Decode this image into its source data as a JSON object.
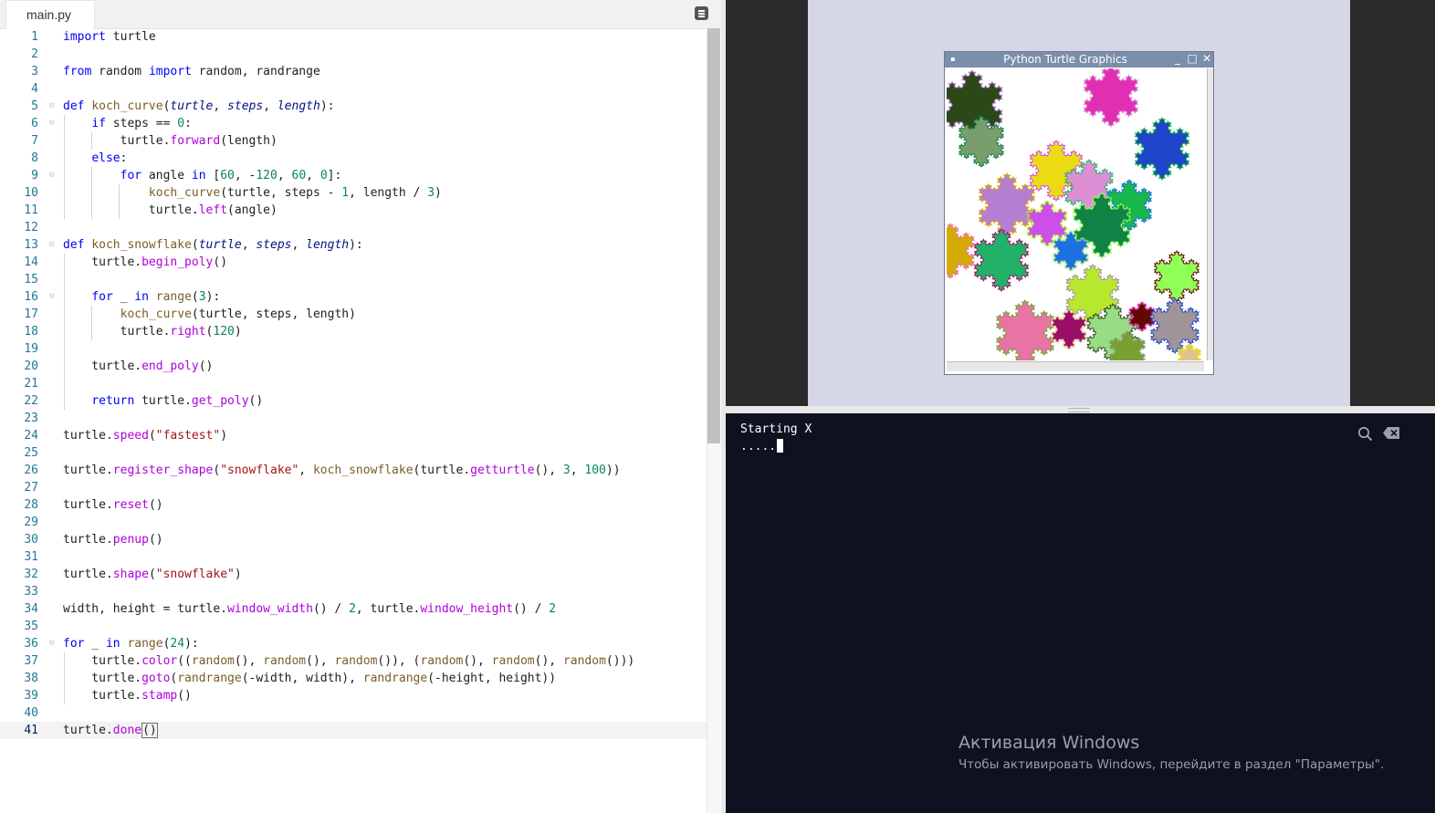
{
  "editor": {
    "tab_name": "main.py",
    "lines": [
      "import turtle",
      "",
      "from random import random, randrange",
      "",
      "def koch_curve(turtle, steps, length):",
      "    if steps == 0:",
      "        turtle.forward(length)",
      "    else:",
      "        for angle in [60, -120, 60, 0]:",
      "            koch_curve(turtle, steps - 1, length / 3)",
      "            turtle.left(angle)",
      "",
      "def koch_snowflake(turtle, steps, length):",
      "    turtle.begin_poly()",
      "",
      "    for _ in range(3):",
      "        koch_curve(turtle, steps, length)",
      "        turtle.right(120)",
      "",
      "    turtle.end_poly()",
      "",
      "    return turtle.get_poly()",
      "",
      "turtle.speed(\"fastest\")",
      "",
      "turtle.register_shape(\"snowflake\", koch_snowflake(turtle.getturtle(), 3, 100))",
      "",
      "turtle.reset()",
      "",
      "turtle.penup()",
      "",
      "turtle.shape(\"snowflake\")",
      "",
      "width, height = turtle.window_width() / 2, turtle.window_height() / 2",
      "",
      "for _ in range(24):",
      "    turtle.color((random(), random(), random()), (random(), random(), random()))",
      "    turtle.goto(randrange(-width, width), randrange(-height, height))",
      "    turtle.stamp()",
      "",
      "turtle.done()"
    ],
    "active_line": 41,
    "line_numbers": [
      "1",
      "2",
      "3",
      "4",
      "5",
      "6",
      "7",
      "8",
      "9",
      "10",
      "11",
      "12",
      "13",
      "14",
      "15",
      "16",
      "17",
      "18",
      "19",
      "20",
      "21",
      "22",
      "23",
      "24",
      "25",
      "26",
      "27",
      "28",
      "29",
      "30",
      "31",
      "32",
      "33",
      "34",
      "35",
      "36",
      "37",
      "38",
      "39",
      "40",
      "41"
    ]
  },
  "turtle_window": {
    "title": "Python Turtle Graphics",
    "snowflake_colors": [
      "#2c4718",
      "#e12fb4",
      "#1f45c8",
      "#7a9d6e",
      "#ecdb13",
      "#b67ed2",
      "#dd8fd6",
      "#17b74a",
      "#108245",
      "#cb4fe8",
      "#d4ab06",
      "#21b169",
      "#1c70e0",
      "#90ff57",
      "#b7e82d",
      "#e774a4",
      "#9b0e68",
      "#99dc86",
      "#5e0a00",
      "#a0949b",
      "#7a9f31",
      "#e0c38c"
    ]
  },
  "console": {
    "line1": "Starting X",
    "line2": ".....",
    "search_icon": "search-icon",
    "clear_icon": "clear-console-icon"
  },
  "watermark": {
    "title": "Активация Windows",
    "subtitle": "Чтобы активировать Windows, перейдите в раздел \"Параметры\"."
  }
}
